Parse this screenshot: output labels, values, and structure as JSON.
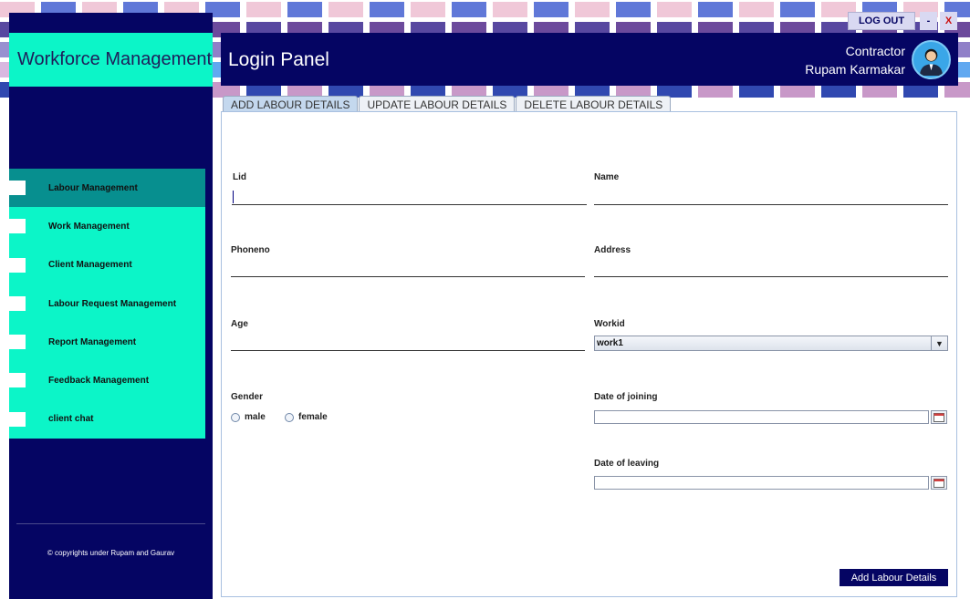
{
  "app": {
    "brand_title": "Workforce Management",
    "panel_title": "Login Panel",
    "copyright": "© copyrights under Rupam and Gaurav"
  },
  "user": {
    "role": "Contractor",
    "name": "Rupam Karmakar"
  },
  "window_controls": {
    "logout_label": "LOG OUT",
    "minimize_label": "-",
    "close_label": "X"
  },
  "sidebar": {
    "items": [
      {
        "label": "Labour Management",
        "active": true
      },
      {
        "label": "Work Management",
        "active": false
      },
      {
        "label": "Client Management",
        "active": false
      },
      {
        "label": "Labour Request Management",
        "active": false
      },
      {
        "label": "Report Management",
        "active": false
      },
      {
        "label": "Feedback Management",
        "active": false
      },
      {
        "label": "client chat",
        "active": false
      }
    ]
  },
  "tabs": [
    {
      "label": "ADD LABOUR DETAILS",
      "active": true
    },
    {
      "label": "UPDATE LABOUR DETAILS",
      "active": false
    },
    {
      "label": "DELETE LABOUR DETAILS",
      "active": false
    }
  ],
  "form": {
    "lid_label": "Lid",
    "lid_value": "",
    "name_label": "Name",
    "name_value": "",
    "phoneno_label": "Phoneno",
    "phoneno_value": "",
    "address_label": "Address",
    "address_value": "",
    "age_label": "Age",
    "age_value": "",
    "workid_label": "Workid",
    "workid_selected": "work1",
    "gender_label": "Gender",
    "gender_options": [
      "male",
      "female"
    ],
    "doj_label": "Date of joining",
    "doj_value": "",
    "dol_label": "Date of leaving",
    "dol_value": "",
    "submit_label": "Add Labour Details"
  },
  "colors": {
    "navy": "#050563",
    "aqua": "#0cf5c8",
    "teal_active": "#078f8f"
  }
}
